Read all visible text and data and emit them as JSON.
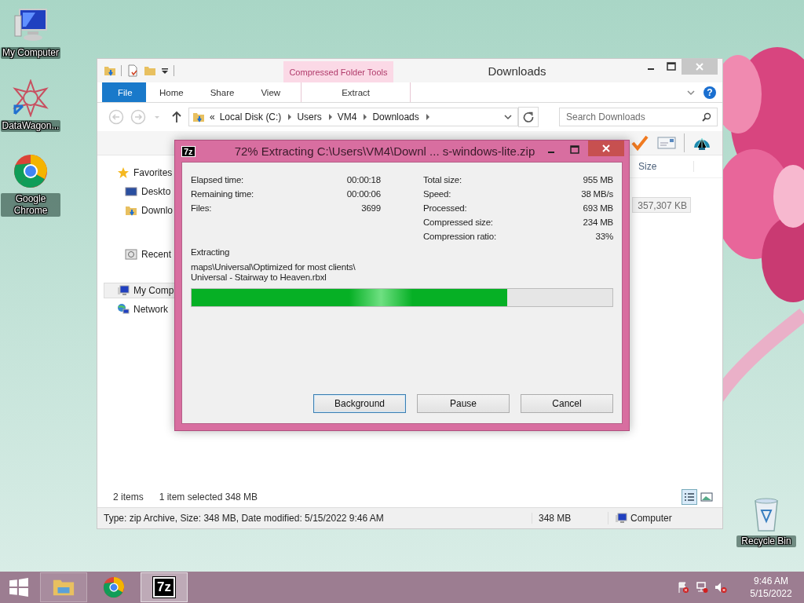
{
  "desktop_icons": [
    {
      "kind": "computer",
      "label": "My Computer"
    },
    {
      "kind": "shortcut",
      "label": "DataWagon..."
    },
    {
      "kind": "chrome",
      "label": "Google Chrome"
    }
  ],
  "recycle_bin": {
    "label": "Recycle Bin"
  },
  "explorer": {
    "title": "Downloads",
    "context_group": "Compressed Folder Tools",
    "tabs": [
      {
        "label": "File",
        "kind": "file",
        "selected": false
      },
      {
        "label": "Home",
        "kind": "main",
        "selected": false
      },
      {
        "label": "Share",
        "kind": "main",
        "selected": false
      },
      {
        "label": "View",
        "kind": "main",
        "selected": false
      },
      {
        "label": "Extract",
        "kind": "context",
        "selected": false
      }
    ],
    "address": {
      "overflow": "«",
      "crumbs": [
        "Local Disk (C:)",
        "Users",
        "VM4",
        "Downloads"
      ]
    },
    "search": {
      "placeholder": "Search Downloads"
    },
    "help": "?",
    "nav": [
      {
        "label": "Favorites",
        "kind": "favorites",
        "selected": false,
        "children": [
          {
            "label": "Deskto",
            "kind": "desktop",
            "selected": false
          },
          {
            "label": "Downlo",
            "kind": "downloads",
            "selected": false
          },
          {
            "label": "Recent",
            "kind": "recent",
            "selected": false
          }
        ]
      },
      {
        "label": "My Comp",
        "kind": "computer",
        "selected": true
      },
      {
        "label": "Network",
        "kind": "network",
        "selected": false
      }
    ],
    "columns": [
      "Size"
    ],
    "rows": [
      {
        "size": "357,307 KB",
        "selected": true
      }
    ],
    "status": {
      "items": "2 items",
      "selection": "1 item selected  348 MB"
    },
    "details": {
      "summary": "Type: zip Archive, Size: 348 MB, Date modified: 5/15/2022 9:46 AM",
      "size": "348 MB",
      "location": "Computer"
    }
  },
  "dialog": {
    "logo": "7z",
    "title": "72% Extracting C:\\Users\\VM4\\Downl ... s-windows-lite.zip",
    "stats_left": [
      {
        "label": "Elapsed time:",
        "value": "00:00:18"
      },
      {
        "label": "Remaining time:",
        "value": "00:00:06"
      },
      {
        "label": "Files:",
        "value": "3699"
      }
    ],
    "stats_right": [
      {
        "label": "Total size:",
        "value": "955 MB"
      },
      {
        "label": "Speed:",
        "value": "38 MB/s"
      },
      {
        "label": "Processed:",
        "value": "693 MB"
      },
      {
        "label": "Compressed size:",
        "value": "234 MB"
      },
      {
        "label": "Compression ratio:",
        "value": "33%"
      }
    ],
    "status": "Extracting",
    "path": [
      "maps\\Universal\\Optimized for most clients\\",
      "Universal - Stairway to Heaven.rbxl"
    ],
    "progress": {
      "level": 0.75
    },
    "buttons": [
      {
        "label": "Background",
        "default": true
      },
      {
        "label": "Pause",
        "default": false
      },
      {
        "label": "Cancel",
        "default": false
      }
    ]
  },
  "taskbar": {
    "apps": [
      {
        "kind": "explorer",
        "running": true,
        "selected": false
      },
      {
        "kind": "chrome",
        "running": false,
        "selected": false
      },
      {
        "kind": "sevenzip",
        "label": "7z",
        "running": true,
        "selected": true
      }
    ],
    "time": "9:46 AM",
    "date": "5/15/2022"
  }
}
